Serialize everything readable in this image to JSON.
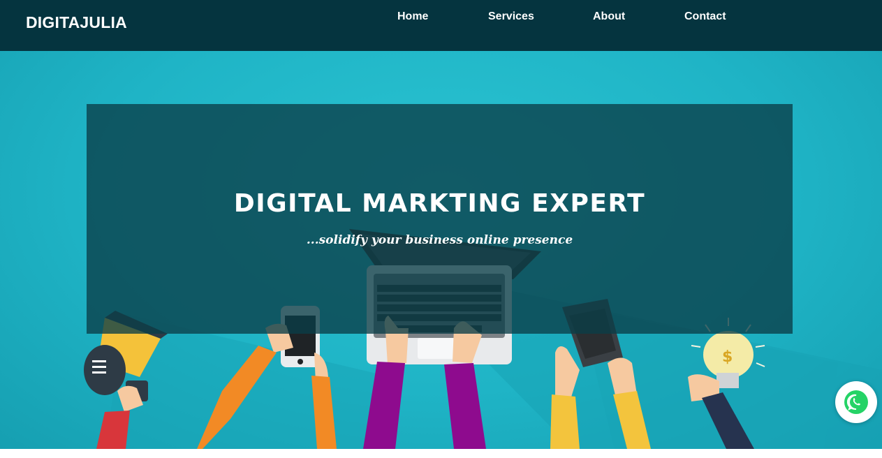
{
  "brand": {
    "name": "DIGITAJULIA"
  },
  "nav": {
    "items": [
      {
        "label": "Home"
      },
      {
        "label": "Services"
      },
      {
        "label": "About"
      },
      {
        "label": "Contact"
      }
    ]
  },
  "hero": {
    "title": "DIGITAL MARKTING EXPERT",
    "subtitle": "...solidify your business online presence",
    "background_color": "#1fb4c6",
    "overlay_color": "#0a3e48"
  },
  "floating": {
    "whatsapp_icon": "whatsapp-icon",
    "whatsapp_color": "#25d366"
  },
  "colors": {
    "navbar": "#05343f",
    "text": "#ffffff"
  }
}
